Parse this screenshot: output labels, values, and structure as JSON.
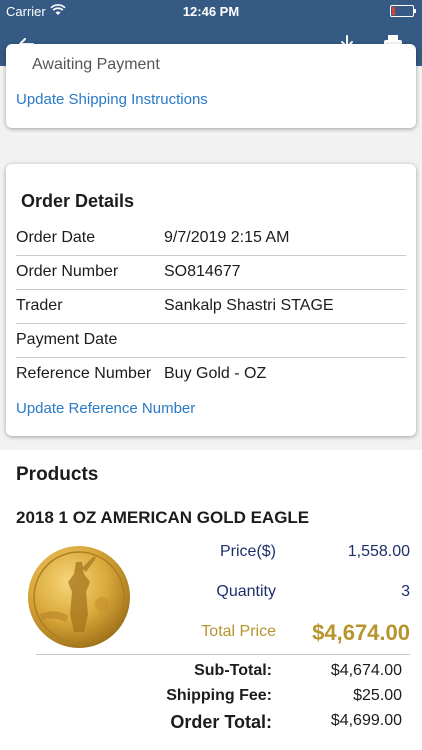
{
  "status_bar": {
    "carrier": "Carrier",
    "time": "12:46 PM"
  },
  "navbar": {
    "back_icon": "back-arrow-icon",
    "download_icon": "download-icon",
    "print_icon": "print-icon",
    "color": "#355b84"
  },
  "shipping_card": {
    "status": "Awaiting Payment",
    "link": "Update Shipping Instructions"
  },
  "order_details": {
    "title": "Order Details",
    "rows": [
      {
        "label": "Order Date",
        "value": "9/7/2019 2:15 AM"
      },
      {
        "label": "Order Number",
        "value": "SO814677"
      },
      {
        "label": "Trader",
        "value": "Sankalp Shastri STAGE"
      },
      {
        "label": "Payment Date",
        "value": ""
      },
      {
        "label": "Reference Number",
        "value": "Buy Gold - OZ"
      }
    ],
    "link": "Update Reference Number"
  },
  "products": {
    "title": "Products",
    "items": [
      {
        "name": "2018 1 OZ AMERICAN GOLD EAGLE",
        "price_label": "Price($)",
        "price": "1,558.00",
        "quantity_label": "Quantity",
        "quantity": "3",
        "total_label": "Total Price",
        "total": "$4,674.00"
      }
    ],
    "summary": {
      "subtotal_label": "Sub-Total:",
      "subtotal": "$4,674.00",
      "shipping_label": "Shipping Fee:",
      "shipping": "$25.00",
      "order_total_label": "Order Total:",
      "order_total": "$4,699.00"
    }
  }
}
